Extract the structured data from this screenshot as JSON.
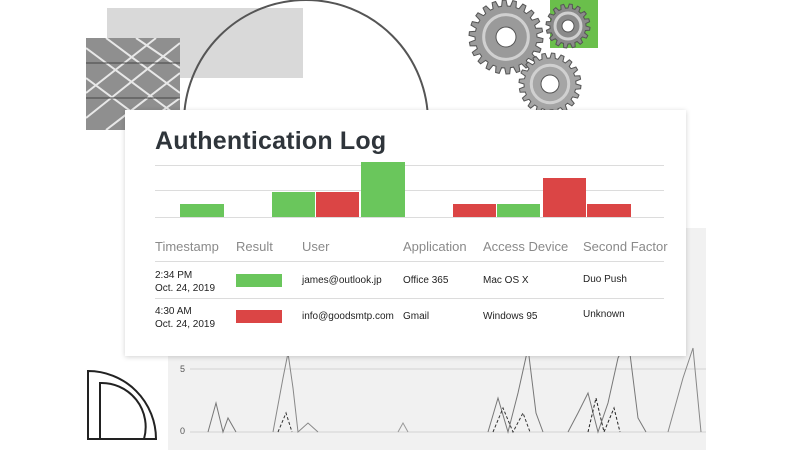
{
  "card": {
    "title": "Authentication Log"
  },
  "bar_chart": {
    "bars": [
      {
        "result": "success",
        "level": 0.24
      },
      {
        "result": "success",
        "level": 0.46
      },
      {
        "result": "failure",
        "level": 0.46
      },
      {
        "result": "success",
        "level": 1.0
      },
      {
        "result": "failure",
        "level": 0.24
      },
      {
        "result": "success",
        "level": 0.24
      },
      {
        "result": "failure",
        "level": 0.7
      },
      {
        "result": "failure",
        "level": 0.24
      }
    ]
  },
  "table": {
    "columns": [
      "Timestamp",
      "Result",
      "User",
      "Application",
      "Access Device",
      "Second Factor"
    ],
    "rows": [
      {
        "time": "2:34 PM",
        "date": "Oct. 24, 2019",
        "result": "success",
        "user": "james@outlook.jp",
        "application": "Office 365",
        "access_device": "Mac OS X",
        "second_factor": "Duo Push"
      },
      {
        "time": "4:30 AM",
        "date": "Oct. 24, 2019",
        "result": "failure",
        "user": "info@goodsmtp.com",
        "application": "Gmail",
        "access_device": "Windows 95",
        "second_factor": "Unknown"
      }
    ]
  },
  "background_chart": {
    "y_ticks": [
      "5",
      "0"
    ]
  },
  "colors": {
    "success": "#6ac65c",
    "failure": "#db4545",
    "accent_green": "#6abf4b",
    "title": "#2f353b"
  },
  "icons": [
    "gear-icon",
    "gear-icon",
    "gear-icon",
    "quarter-circle-icon"
  ]
}
